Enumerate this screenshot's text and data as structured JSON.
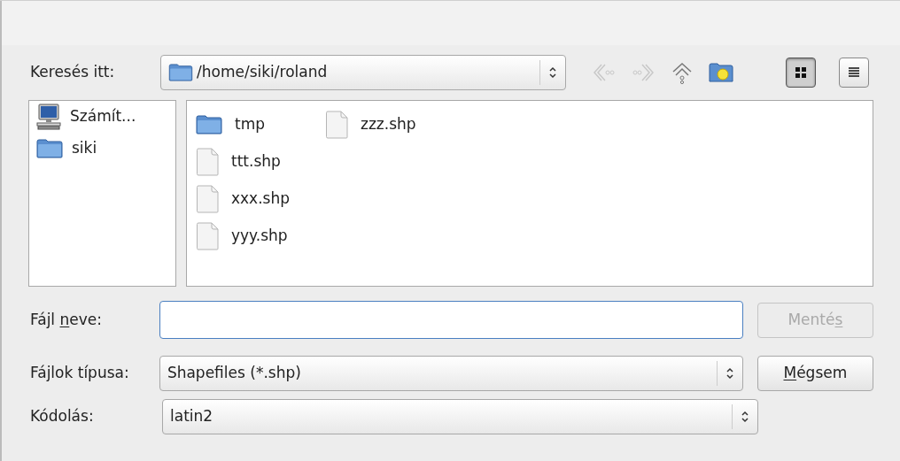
{
  "location": {
    "label": "Keresés itt:",
    "path": "/home/siki/roland"
  },
  "toolbar": [
    {
      "kind": "back",
      "disabled": true
    },
    {
      "kind": "forward",
      "disabled": true
    },
    {
      "kind": "up",
      "disabled": false
    },
    {
      "kind": "new-folder",
      "disabled": false
    }
  ],
  "view_buttons": [
    {
      "kind": "icons",
      "selected": true
    },
    {
      "kind": "list",
      "selected": false
    }
  ],
  "places": [
    {
      "kind": "computer",
      "label": "Számít..."
    },
    {
      "kind": "folder",
      "label": "siki"
    }
  ],
  "files": [
    {
      "kind": "folder",
      "name": "tmp"
    },
    {
      "kind": "file",
      "name": "ttt.shp"
    },
    {
      "kind": "file",
      "name": "xxx.shp"
    },
    {
      "kind": "file",
      "name": "yyy.shp"
    },
    {
      "kind": "file",
      "name": "zzz.shp"
    }
  ],
  "filename": {
    "label": {
      "before": "Fájl ",
      "key": "n",
      "after": "eve:"
    }
  },
  "save_button": {
    "label": {
      "before": "Menté",
      "key": "s"
    },
    "disabled": true
  },
  "filetype": {
    "label": "Fájlok típusa:",
    "value": "Shapefiles (*.shp)"
  },
  "cancel_button": {
    "label": {
      "key": "M",
      "after": "égsem"
    },
    "disabled": false
  },
  "encoding": {
    "label": "Kódolás:",
    "value": "latin2"
  }
}
